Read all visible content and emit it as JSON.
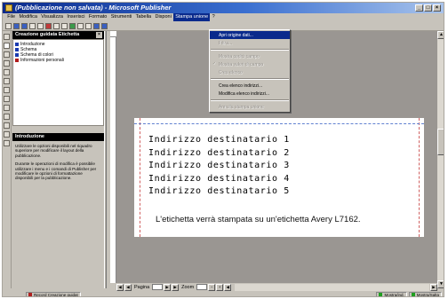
{
  "window": {
    "title": "(Pubblicazione non salvata) - Microsoft Publisher",
    "buttons": {
      "minimize": "_",
      "maximize": "□",
      "close": "×"
    }
  },
  "menubar": [
    "File",
    "Modifica",
    "Visualizza",
    "Inserisci",
    "Formato",
    "Strumenti",
    "Tabella",
    "Disponi",
    "Stampa unione",
    "?"
  ],
  "menu_open_index": 8,
  "mail_merge_menu": {
    "items": [
      {
        "label": "Apri origine dati...",
        "state": "highlight"
      },
      {
        "label": "Filtra...",
        "state": "disabled"
      },
      {
        "type": "separator"
      },
      {
        "label": "Mostra codici campo",
        "state": "disabled"
      },
      {
        "label": "Mostra valori di campo",
        "state": "disabled",
        "checked": true
      },
      {
        "label": "Crea elenco",
        "state": "disabled"
      },
      {
        "type": "separator"
      },
      {
        "label": "Crea elenco indirizzi...",
        "state": "normal"
      },
      {
        "label": "Modifica elenco indirizzi...",
        "state": "normal"
      },
      {
        "type": "separator"
      },
      {
        "label": "Annulla stampa unione",
        "state": "disabled"
      }
    ]
  },
  "wizard": {
    "header": "Creazione guidata Etichetta",
    "close_glyph": "×",
    "steps": [
      {
        "label": "Introduzione",
        "color": "#1a3ab0",
        "current": true
      },
      {
        "label": "Schema",
        "color": "#1a3ab0"
      },
      {
        "label": "Schema di colori",
        "color": "#1a3ab0"
      },
      {
        "label": "Informazioni personali",
        "color": "#b01a1a"
      }
    ],
    "info_header": "Introduzione",
    "info_paragraphs": [
      "Utilizzare le opzioni disponibili nel riquadro superiore per modificare il layout della pubblicazione.",
      "Durante le operazioni di modifica è possibile utilizzare i menu e i comandi di Publisher per modificare le opzioni di formattazione disponibili per la pubblicazione."
    ]
  },
  "label": {
    "addresses": [
      "Indirizzo destinatario 1",
      "Indirizzo destinatario 2",
      "Indirizzo destinatario 3",
      "Indirizzo destinatario 4",
      "Indirizzo destinatario 5"
    ],
    "note": "L'etichetta verrà stampata su un'etichetta Avery L7162."
  },
  "navbar": {
    "page_label": "Pagina",
    "zoom_label": "Zoom"
  },
  "statusbar": {
    "task_button": "Record Creazione guidat",
    "cell_a": "Mostra/ind.",
    "cell_b": "Mostra/Salta"
  }
}
